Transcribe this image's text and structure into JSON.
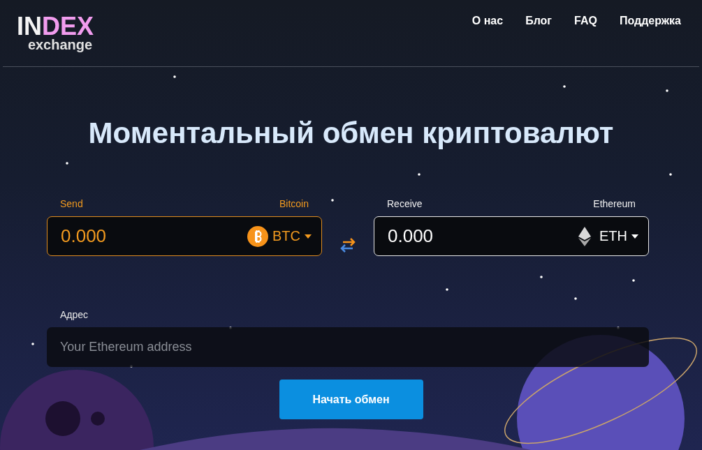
{
  "logo": {
    "white_part": "IN",
    "pink_part": "DEX",
    "subtitle": "exchange"
  },
  "nav": [
    {
      "label": "О нас"
    },
    {
      "label": "Блог"
    },
    {
      "label": "FAQ"
    },
    {
      "label": "Поддержка"
    }
  ],
  "title": "Моментальный обмен криптовалют",
  "panels": [
    {
      "kind": "send",
      "label": "Send",
      "currency_name": "Bitcoin",
      "amount": "0.000",
      "ticker": "BTC"
    },
    {
      "kind": "receive",
      "label": "Receive",
      "currency_name": "Ethereum",
      "amount": "0.000",
      "ticker": "ETH"
    }
  ],
  "address": {
    "label": "Адрес",
    "placeholder": "Your Ethereum address"
  },
  "submit_button": "Начать обмен"
}
